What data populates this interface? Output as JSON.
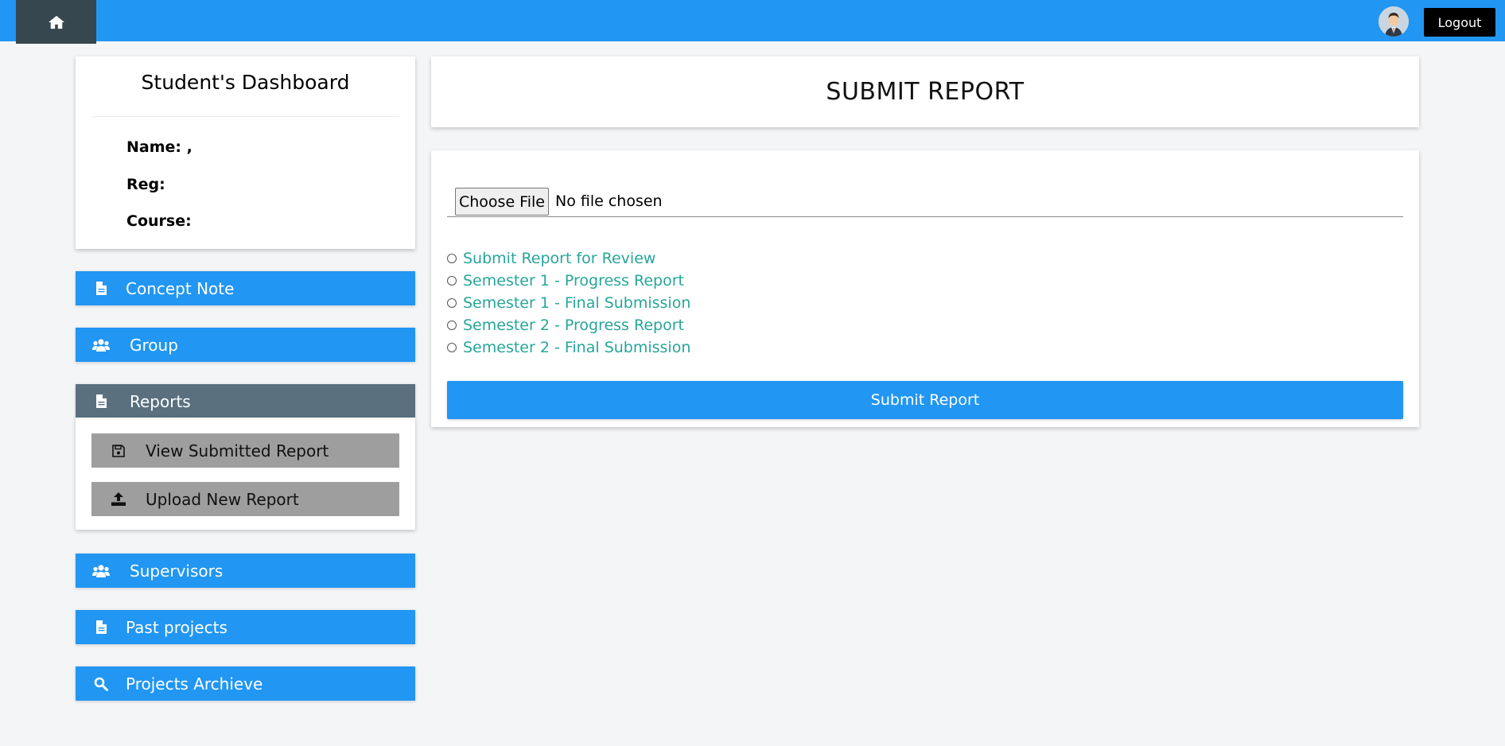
{
  "header": {
    "home_icon": "home-icon",
    "avatar_icon": "user-avatar",
    "logout_label": "Logout",
    "bar_color": "#2196f3"
  },
  "profile": {
    "title": "Student's Dashboard",
    "name_label": "Name: ,",
    "reg_label": "Reg:",
    "course_label": "Course:"
  },
  "sidebar": {
    "items": [
      {
        "label": "Concept Note",
        "icon": "file-icon"
      },
      {
        "label": "Group",
        "icon": "group-icon"
      },
      {
        "label": "Reports",
        "icon": "file-icon",
        "active": true
      },
      {
        "label": "Supervisors",
        "icon": "group-icon"
      },
      {
        "label": "Past projects",
        "icon": "file-icon"
      },
      {
        "label": "Projects Archieve",
        "icon": "search-icon"
      }
    ],
    "reports_sub": [
      {
        "label": "View Submitted Report",
        "icon": "save-icon"
      },
      {
        "label": "Upload New Report",
        "icon": "upload-icon"
      }
    ]
  },
  "main": {
    "title": "SUBMIT REPORT",
    "file_button": "Choose File",
    "file_status": "No file chosen",
    "report_options": [
      "Submit Report for Review",
      "Semester 1 - Progress Report",
      "Semester 1 - Final Submission",
      "Semester 2 - Progress Report",
      "Semester 2 - Final Submission"
    ],
    "submit_label": "Submit Report",
    "option_color": "#26a69a"
  }
}
